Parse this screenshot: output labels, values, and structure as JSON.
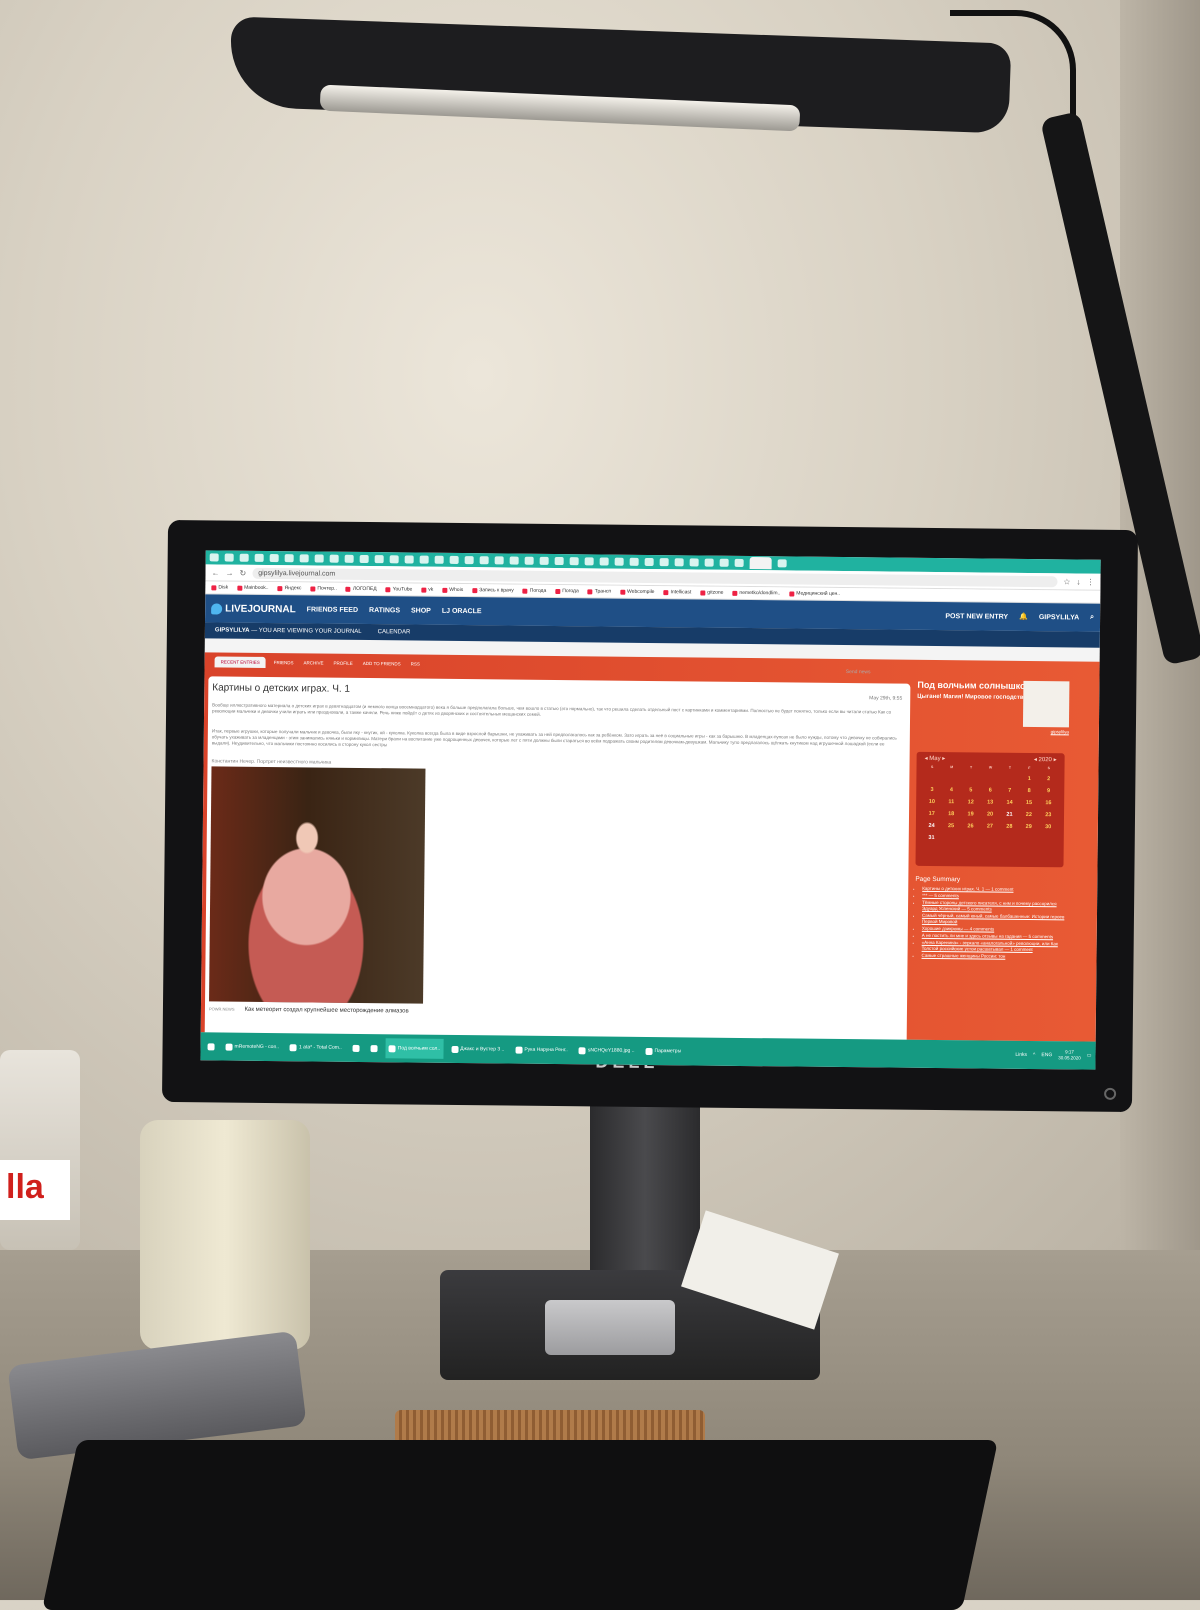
{
  "browser": {
    "url": "gipsylilya.livejournal.com",
    "bookmarks": [
      "Disk",
      "Mainbook..",
      "Яндекс",
      "Почтер..",
      "ЛОГОПЕД",
      "YouTube",
      "vk",
      "Whois",
      "Запись к врачу",
      "Погода",
      "Погода",
      "Трансп",
      "Webcompile",
      "Intellicast",
      "gitzone",
      "nemetko/dondlim..",
      "Медицинский цен.."
    ]
  },
  "lj": {
    "logo": "LIVEJOURNAL",
    "nav": [
      "FRIENDS FEED",
      "RATINGS",
      "SHOP",
      "LJ ORACLE"
    ],
    "post_new": "POST NEW ENTRY",
    "user": "GIPSYLILYA",
    "viewing": "GIPSYLILYA",
    "viewing_suffix": " — YOU ARE VIEWING YOUR JOURNAL",
    "calendar_link": "CALENDAR"
  },
  "journal_tabs": [
    "RECENT ENTRIES",
    "FRIENDS",
    "ARCHIVE",
    "PROFILE",
    "ADD TO FRIENDS",
    "RSS"
  ],
  "entry": {
    "title": "Картины о детских играх. Ч. 1",
    "date": "May 29th, 9:55",
    "para1": "Вообще иллюстративного материала о детских играх в девятнадцатом (и немного конца восемнадцатого) века я больше предполагала больше, чем вошло в статью (это нормально), так что решила сделать отдельный пост с картинками и комментариями. Полностью не будет понятно, только если вы читали статью Как со революции мальчики и девочки учили играть или праздновали, а также качели. Речь ниже пойдёт о детях из дворянских и состоятельных мещанских семей.",
    "para2": "Итак, первые игрушки, которые получали мальчик и девочка, были яку - кнутик, ой - куколка. Куколка всегда была в виде взрослой барышни, не ухаживать за ней предполагалось как за ребёнком. Зато играть за неё в социальные игры - как за барышню. В младенцах-пупсах не было нужды, потому что девочку не собирались обучать ухаживать за младенцами - этим занимались няньки и кормилицы. Матери брали на воспитание уже подрощенных девочек, которые лет с пяти должны были стараться во всём подражать своим родителям девочкам-девушкам. Мальчику тупо предлагалось щёлкать кнутиком над игрушечной лошадкой (если ее выдали). Неудивительно, что мальчики постоянно косились в сторону кукол сестры",
    "caption": "Константин Нечер. Портрет неизвестного мальчика",
    "next_label": "POWR.NEWS",
    "next_title": "Как метеорит создал крупнейшее месторождение алмазов"
  },
  "sidebar": {
    "title": "Под волчьим солнышком",
    "subtitle": "Цыгане! Магия! Мировое господство!",
    "user": "gipsylilya",
    "month": "May",
    "year": "2020",
    "dow": [
      "S",
      "M",
      "T",
      "W",
      "T",
      "F",
      "S"
    ],
    "days": [
      "",
      "",
      "",
      "",
      "",
      "1",
      "2",
      "3",
      "4",
      "5",
      "6",
      "7",
      "8",
      "9",
      "10",
      "11",
      "12",
      "13",
      "14",
      "15",
      "16",
      "17",
      "18",
      "19",
      "20",
      "21",
      "22",
      "23",
      "24",
      "25",
      "26",
      "27",
      "28",
      "29",
      "30",
      "31",
      "",
      "",
      "",
      "",
      "",
      ""
    ],
    "summary_title": "Page Summary",
    "summary_items": [
      "Картины о детских играх. Ч. 1 — 1 comment",
      "*** — 5 comments",
      "Тёмные стороны детского писателя, с ним и почему рассорился Эдуард Успенский — 5 comments",
      "Самый чёрный, самый юный, самые балбашенные: Истории героев Первой Мировой",
      "Хорошие дзикромы — 4 comments",
      "А не постить ли мне и здесь отзывы на гадания — 5 comments",
      "«Анна Каренина» - зеркало «аналогальной» революции, или Как Толстой российские устои расшатывал — 1 comment",
      "Самые страшные женщины России: тон"
    ]
  },
  "send_news": "Send news",
  "taskbar": {
    "items": [
      "mRemoteNG - con..",
      "1 ata* - Total Com..",
      "Под волчьим сол..",
      "Джакс и Вустер 3 ..",
      "Рука Наруна Ренг..",
      "sNCHQeY1880.jpg ..",
      "Параметры"
    ],
    "links": "Links",
    "lang": "ENG",
    "time": "9:17",
    "date": "30.05.2020"
  },
  "monitor_brand": "DELL",
  "nutella_text": "lla"
}
